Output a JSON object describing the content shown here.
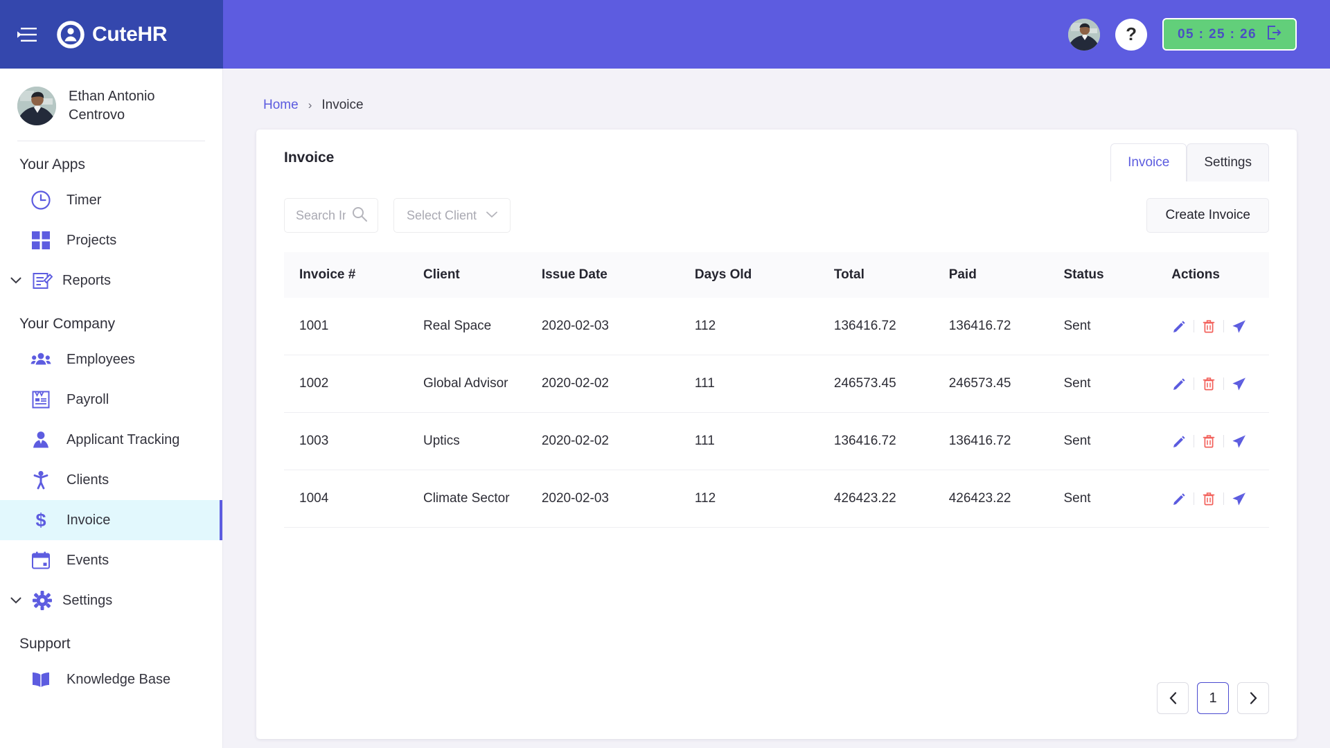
{
  "header": {
    "brand_name": "CuteHR",
    "menu_icon": "hamburger-collapse-icon",
    "logo_icon": "cutehr-person-logo-icon",
    "help_label": "?",
    "timer_value": "05 : 25 : 26",
    "timer_icon": "clock-out-icon",
    "colors": {
      "brand_bg": "#3447ad",
      "header_bg": "#5d5ce0",
      "timer_bg": "#62cf7a",
      "timer_text": "#4a4fc4"
    }
  },
  "sidebar": {
    "user": {
      "name": "Ethan Antonio Centrovo",
      "avatar": "user-avatar"
    },
    "groups": [
      {
        "title": "Your Apps",
        "items": [
          {
            "label": "Timer",
            "icon": "clock-icon",
            "active": false,
            "chevron": false
          },
          {
            "label": "Projects",
            "icon": "grid-icon",
            "active": false,
            "chevron": false
          },
          {
            "label": "Reports",
            "icon": "report-edit-icon",
            "active": false,
            "chevron": true
          }
        ]
      },
      {
        "title": "Your Company",
        "items": [
          {
            "label": "Employees",
            "icon": "people-icon",
            "active": false,
            "chevron": false
          },
          {
            "label": "Payroll",
            "icon": "payroll-card-icon",
            "active": false,
            "chevron": false
          },
          {
            "label": "Applicant Tracking",
            "icon": "applicant-icon",
            "active": false,
            "chevron": false
          },
          {
            "label": "Clients",
            "icon": "client-person-icon",
            "active": false,
            "chevron": false
          },
          {
            "label": "Invoice",
            "icon": "dollar-icon",
            "active": true,
            "chevron": false
          },
          {
            "label": "Events",
            "icon": "calendar-icon",
            "active": false,
            "chevron": false
          },
          {
            "label": "Settings",
            "icon": "gear-icon",
            "active": false,
            "chevron": true
          }
        ]
      },
      {
        "title": "Support",
        "items": [
          {
            "label": "Knowledge Base",
            "icon": "book-icon",
            "active": false,
            "chevron": false
          }
        ]
      }
    ],
    "active_accent": "#5d5ce0",
    "active_bg": "#e2f8fd"
  },
  "breadcrumb": {
    "home": "Home",
    "separator": "›",
    "current": "Invoice"
  },
  "card": {
    "title": "Invoice",
    "tabs": [
      {
        "label": "Invoice",
        "active": true
      },
      {
        "label": "Settings",
        "active": false
      }
    ],
    "toolbar": {
      "search_placeholder": "Search Invoice  #",
      "search_value": "",
      "search_icon": "search-icon",
      "select_client_label": "Select Client",
      "select_chevron": "chevron-down-icon",
      "create_invoice_label": "Create Invoice"
    },
    "table": {
      "columns": [
        "Invoice #",
        "Client",
        "Issue Date",
        "Days Old",
        "Total",
        "Paid",
        "Status",
        "Actions"
      ],
      "rows": [
        {
          "invoice": "1001",
          "client": "Real Space",
          "issue_date": "2020-02-03",
          "days_old": "112",
          "total": "136416.72",
          "paid": "136416.72",
          "status": "Sent"
        },
        {
          "invoice": "1002",
          "client": "Global Advisor",
          "issue_date": "2020-02-02",
          "days_old": "111",
          "total": "246573.45",
          "paid": "246573.45",
          "status": "Sent"
        },
        {
          "invoice": "1003",
          "client": "Uptics",
          "issue_date": "2020-02-02",
          "days_old": "111",
          "total": "136416.72",
          "paid": "136416.72",
          "status": "Sent"
        },
        {
          "invoice": "1004",
          "client": "Climate Sector",
          "issue_date": "2020-02-03",
          "days_old": "112",
          "total": "426423.22",
          "paid": "426423.22",
          "status": "Sent"
        }
      ],
      "row_actions": [
        {
          "icon": "edit-pencil-icon",
          "color": "#5b5bdf"
        },
        {
          "icon": "delete-trash-icon",
          "color": "#f2605a"
        },
        {
          "icon": "send-paper-plane-icon",
          "color": "#5b5bdf"
        }
      ]
    },
    "pagination": {
      "prev_icon": "chevron-left-icon",
      "next_icon": "chevron-right-icon",
      "pages": [
        "1"
      ],
      "current_page": "1"
    }
  }
}
